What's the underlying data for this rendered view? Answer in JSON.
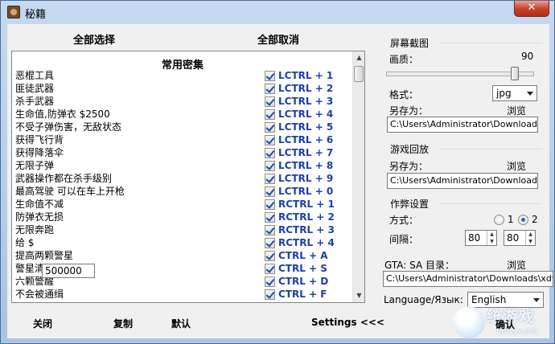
{
  "window": {
    "title": "秘籍",
    "close_glyph": "✕"
  },
  "toolbar": {
    "select_all": "全部选择",
    "deselect_all": "全部取消"
  },
  "cheat_list": {
    "title": "常用密集",
    "items": [
      {
        "name": "恶棍工具",
        "key": "LCTRL + 1"
      },
      {
        "name": "匪徒武器",
        "key": "LCTRL + 2"
      },
      {
        "name": "杀手武器",
        "key": "LCTRL + 3"
      },
      {
        "name": "生命值,防弹衣 $2500",
        "key": "LCTRL + 4"
      },
      {
        "name": "不受子弹伤害，无敌状态",
        "key": "LCTRL + 5"
      },
      {
        "name": "获得飞行背",
        "key": "LCTRL + 6"
      },
      {
        "name": "获得降落伞",
        "key": "LCTRL + 7"
      },
      {
        "name": "无限子弹",
        "key": "LCTRL + 8"
      },
      {
        "name": "武器操作都在杀手级别",
        "key": "LCTRL + 9"
      },
      {
        "name": "最高驾驶 可以在车上开枪",
        "key": "LCTRL + 0"
      },
      {
        "name": "生命值不减",
        "key": "RCTRL + 1"
      },
      {
        "name": "防弹衣无损",
        "key": "RCTRL + 2"
      },
      {
        "name": "无限奔跑",
        "key": "RCTRL + 3"
      },
      {
        "name": "给 $",
        "key": "RCTRL + 4"
      },
      {
        "name": "提高两颗警星",
        "key": "CTRL + A"
      },
      {
        "name": "警星清零",
        "key": "CTRL + S"
      },
      {
        "name": "六颗警醒",
        "key": "CTRL + D"
      },
      {
        "name": "不会被通缉",
        "key": "CTRL + F"
      }
    ],
    "money_value": "500000"
  },
  "bottom": {
    "close": "关闭",
    "copy": "复制",
    "default": "默认",
    "settings": "Settings <<<",
    "confirm": "确认"
  },
  "screenshot": {
    "title": "屏幕截图",
    "quality_label": "画质：",
    "quality_value": "90",
    "quality_fraction": 0.9,
    "format_label": "格式：",
    "format_value": "jpg",
    "save_as_label": "另存为：",
    "browse": "浏览",
    "path": "C:\\Users\\Administrator\\Downloads\\xc"
  },
  "replay": {
    "title": "游戏回放",
    "save_as_label": "另存为：",
    "browse": "浏览",
    "path": "C:\\Users\\Administrator\\Downloads\\xc"
  },
  "cheat_settings": {
    "title": "作弊设置",
    "mode_label": "方式：",
    "mode_options": [
      "1",
      "2"
    ],
    "mode_selected": "2",
    "interval_label": "间隔：",
    "interval_a": "80",
    "interval_b": "80"
  },
  "gta_dir": {
    "label": "GTA: SA 目录：",
    "browse": "浏览",
    "path": "C:\\Users\\Administrator\\Downloads\\xdfcs"
  },
  "language": {
    "label": "Language/Язык:",
    "value": "English"
  },
  "watermark": {
    "text": "统游戏",
    "sub": "newyx.net"
  },
  "colors": {
    "key_text": "#1f3fa8",
    "frame": "#a9c4e4"
  }
}
